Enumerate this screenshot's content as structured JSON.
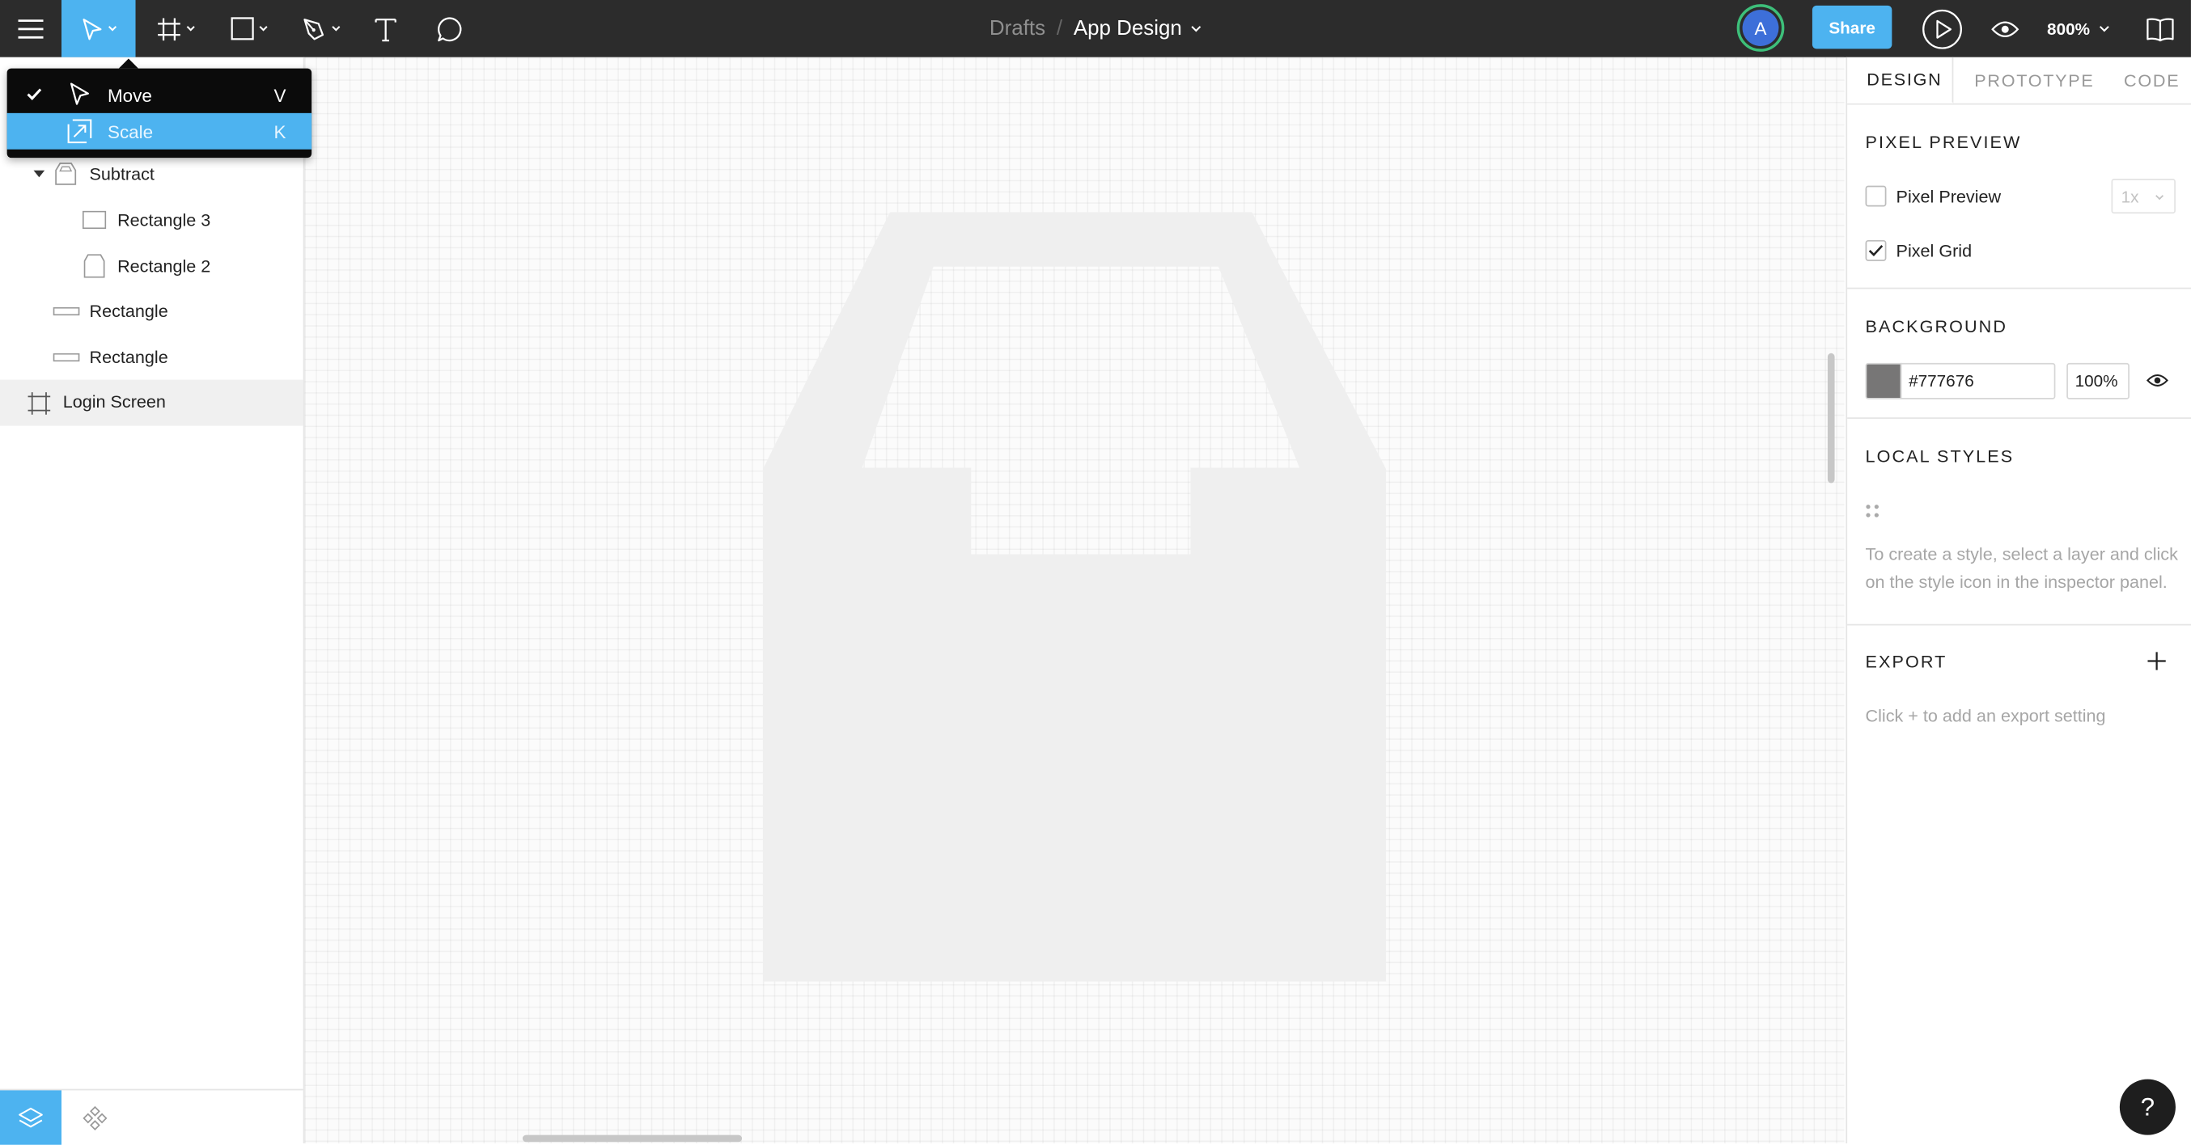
{
  "toolbar": {
    "breadcrumb_parent": "Drafts",
    "breadcrumb_separator": "/",
    "file_name": "App Design",
    "share_label": "Share",
    "avatar_initial": "A",
    "zoom_level": "800%",
    "icons": [
      "menu-icon",
      "move-tool-icon",
      "frame-tool-icon",
      "rectangle-tool-icon",
      "pen-tool-icon",
      "text-tool-icon",
      "comment-tool-icon",
      "present-icon",
      "view-icon",
      "library-icon"
    ]
  },
  "tool_menu": {
    "items": [
      {
        "label": "Move",
        "shortcut": "V",
        "checked": true
      },
      {
        "label": "Scale",
        "shortcut": "K",
        "highlighted": true
      }
    ]
  },
  "layers": [
    {
      "name": "Subtract",
      "icon": "subtract-icon",
      "expanded": true
    },
    {
      "name": "Rectangle 3",
      "icon": "rectangle-icon"
    },
    {
      "name": "Rectangle 2",
      "icon": "rectangle-icon"
    },
    {
      "name": "Rectangle",
      "icon": "rectangle-icon"
    },
    {
      "name": "Rectangle",
      "icon": "rectangle-icon"
    },
    {
      "name": "Login Screen",
      "icon": "frame-icon",
      "selected": true
    }
  ],
  "inspector": {
    "tabs": [
      "DESIGN",
      "PROTOTYPE",
      "CODE"
    ],
    "active_tab": "DESIGN",
    "pixel_preview": {
      "title": "PIXEL PREVIEW",
      "preview_label": "Pixel Preview",
      "preview_checked": false,
      "preview_scale": "1x",
      "grid_label": "Pixel Grid",
      "grid_checked": true
    },
    "background": {
      "title": "BACKGROUND",
      "color": "#777676",
      "hex_value": "#777676",
      "opacity": "100%"
    },
    "local_styles": {
      "title": "LOCAL STYLES",
      "hint": "To create a style, select a layer and click on the style icon in the inspector panel."
    },
    "export": {
      "title": "EXPORT",
      "hint": "Click + to add an export setting"
    }
  },
  "help_label": "?",
  "colors": {
    "accent": "#4db3f0",
    "toolbar_bg": "#2c2c2c",
    "avatar_ring": "#3dbf7a",
    "avatar_bg": "#3d6fd9",
    "canvas_shape": "#efefef"
  }
}
